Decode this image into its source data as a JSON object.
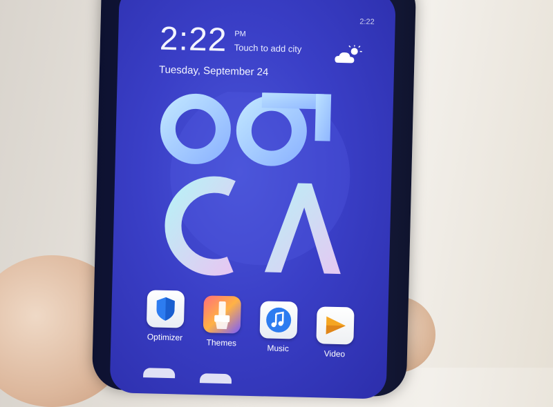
{
  "lockscreen": {
    "time": "2:22",
    "ampm": "PM",
    "city_prompt": "Touch to add city",
    "date": "Tuesday, September 24",
    "status_time": "2:22",
    "weather_icon": "partly-cloudy-icon"
  },
  "apps": [
    {
      "label": "Optimizer",
      "icon": "shield-icon"
    },
    {
      "label": "Themes",
      "icon": "paintbrush-icon"
    },
    {
      "label": "Music",
      "icon": "music-note-icon"
    },
    {
      "label": "Video",
      "icon": "play-icon"
    }
  ],
  "colors": {
    "wallpaper": "#3a3fc7",
    "accent_blue": "#2d7cf0",
    "video_orange": "#f5a623"
  }
}
